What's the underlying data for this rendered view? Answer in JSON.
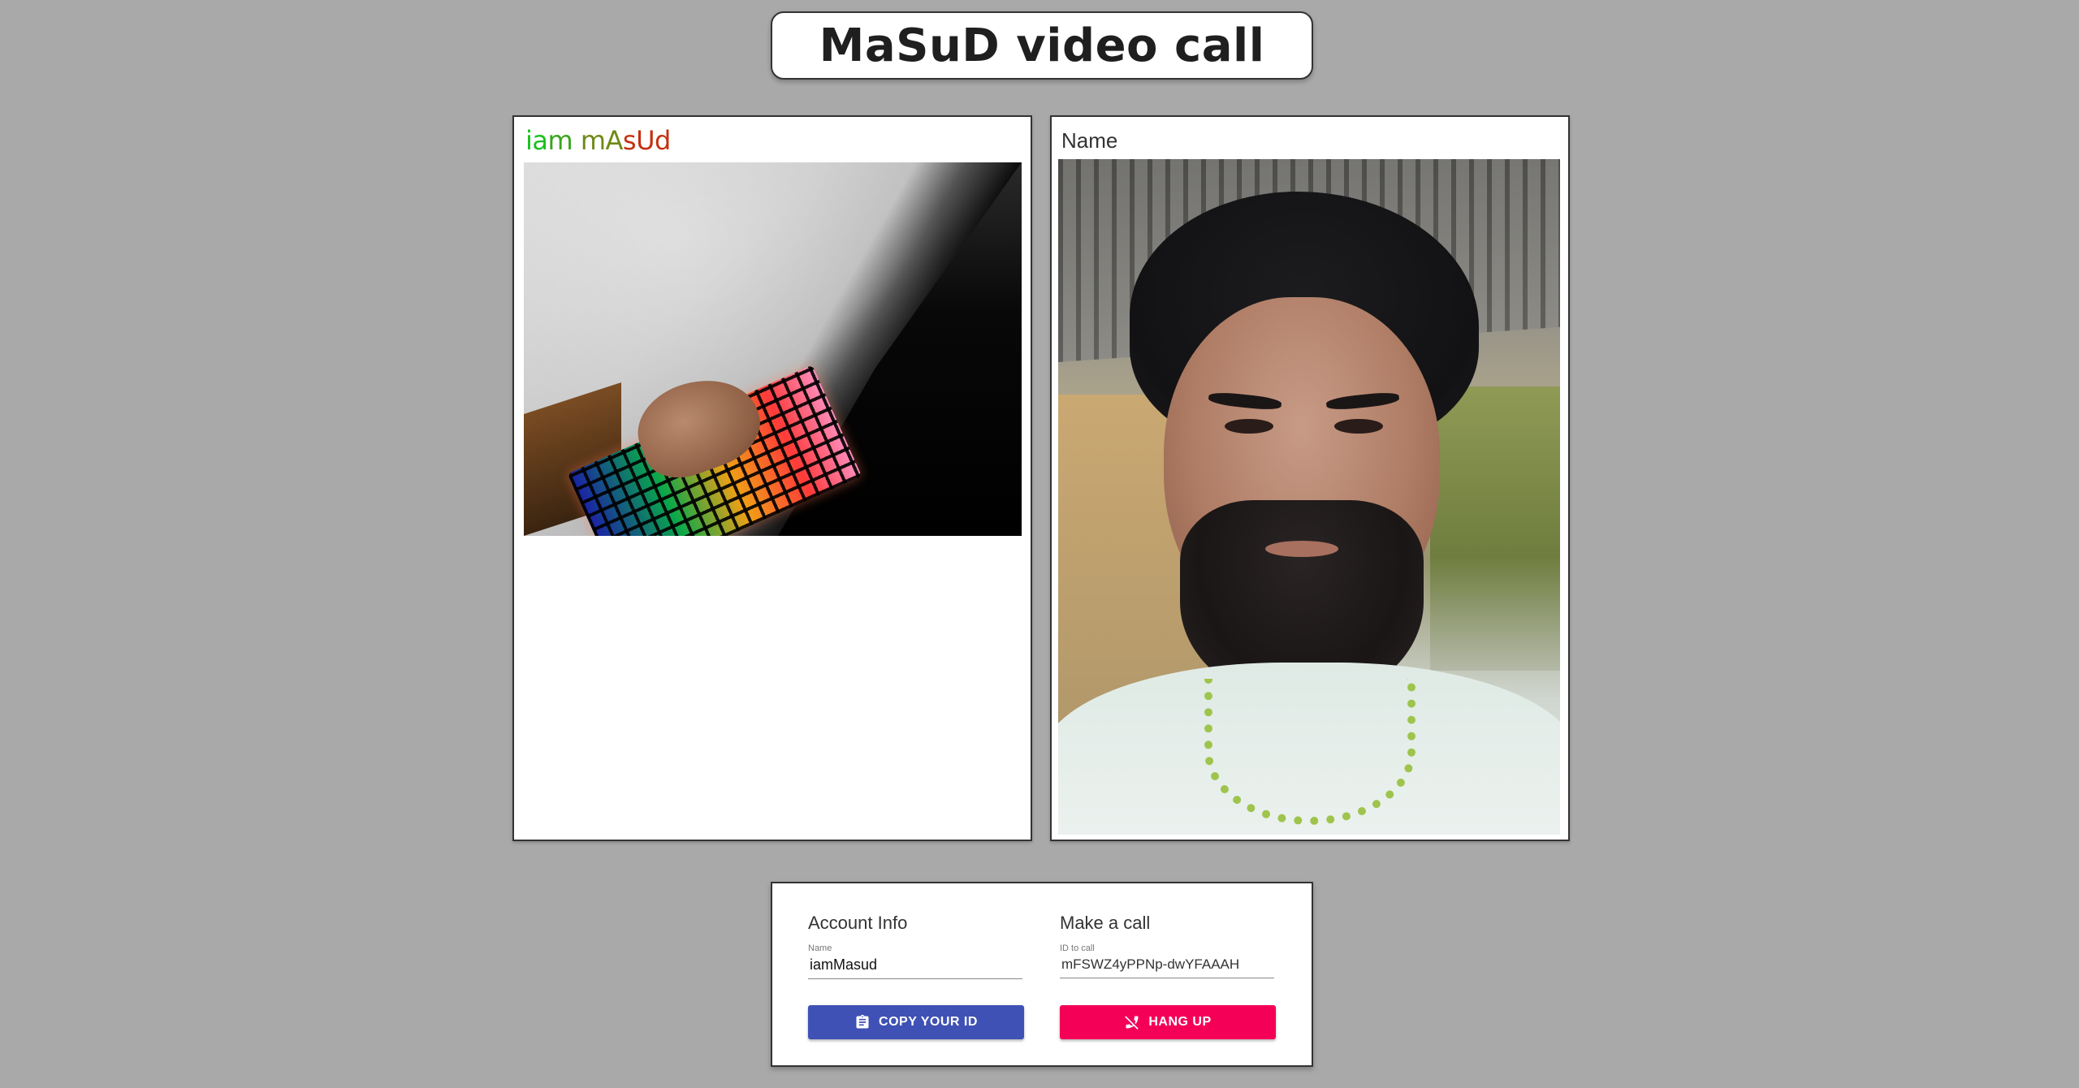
{
  "header": {
    "title": "MaSuD video call"
  },
  "local": {
    "name_parts": [
      "ia",
      "m ",
      "mA",
      "sUd"
    ],
    "name": "iam mAsUd"
  },
  "remote": {
    "name_label": "Name"
  },
  "account": {
    "heading": "Account Info",
    "name_label": "Name",
    "name_value": "iamMasud",
    "copy_button": "COPY YOUR ID"
  },
  "call": {
    "heading": "Make a call",
    "id_label": "ID to call",
    "id_value": "mFSWZ4yPPNp-dwYFAAAH",
    "hangup_button": "HANG UP"
  },
  "colors": {
    "background": "#a9a9a9",
    "copy_button": "#3f51b5",
    "hangup_button": "#f50057"
  },
  "icons": [
    "clipboard-icon",
    "phone-disabled-icon"
  ]
}
